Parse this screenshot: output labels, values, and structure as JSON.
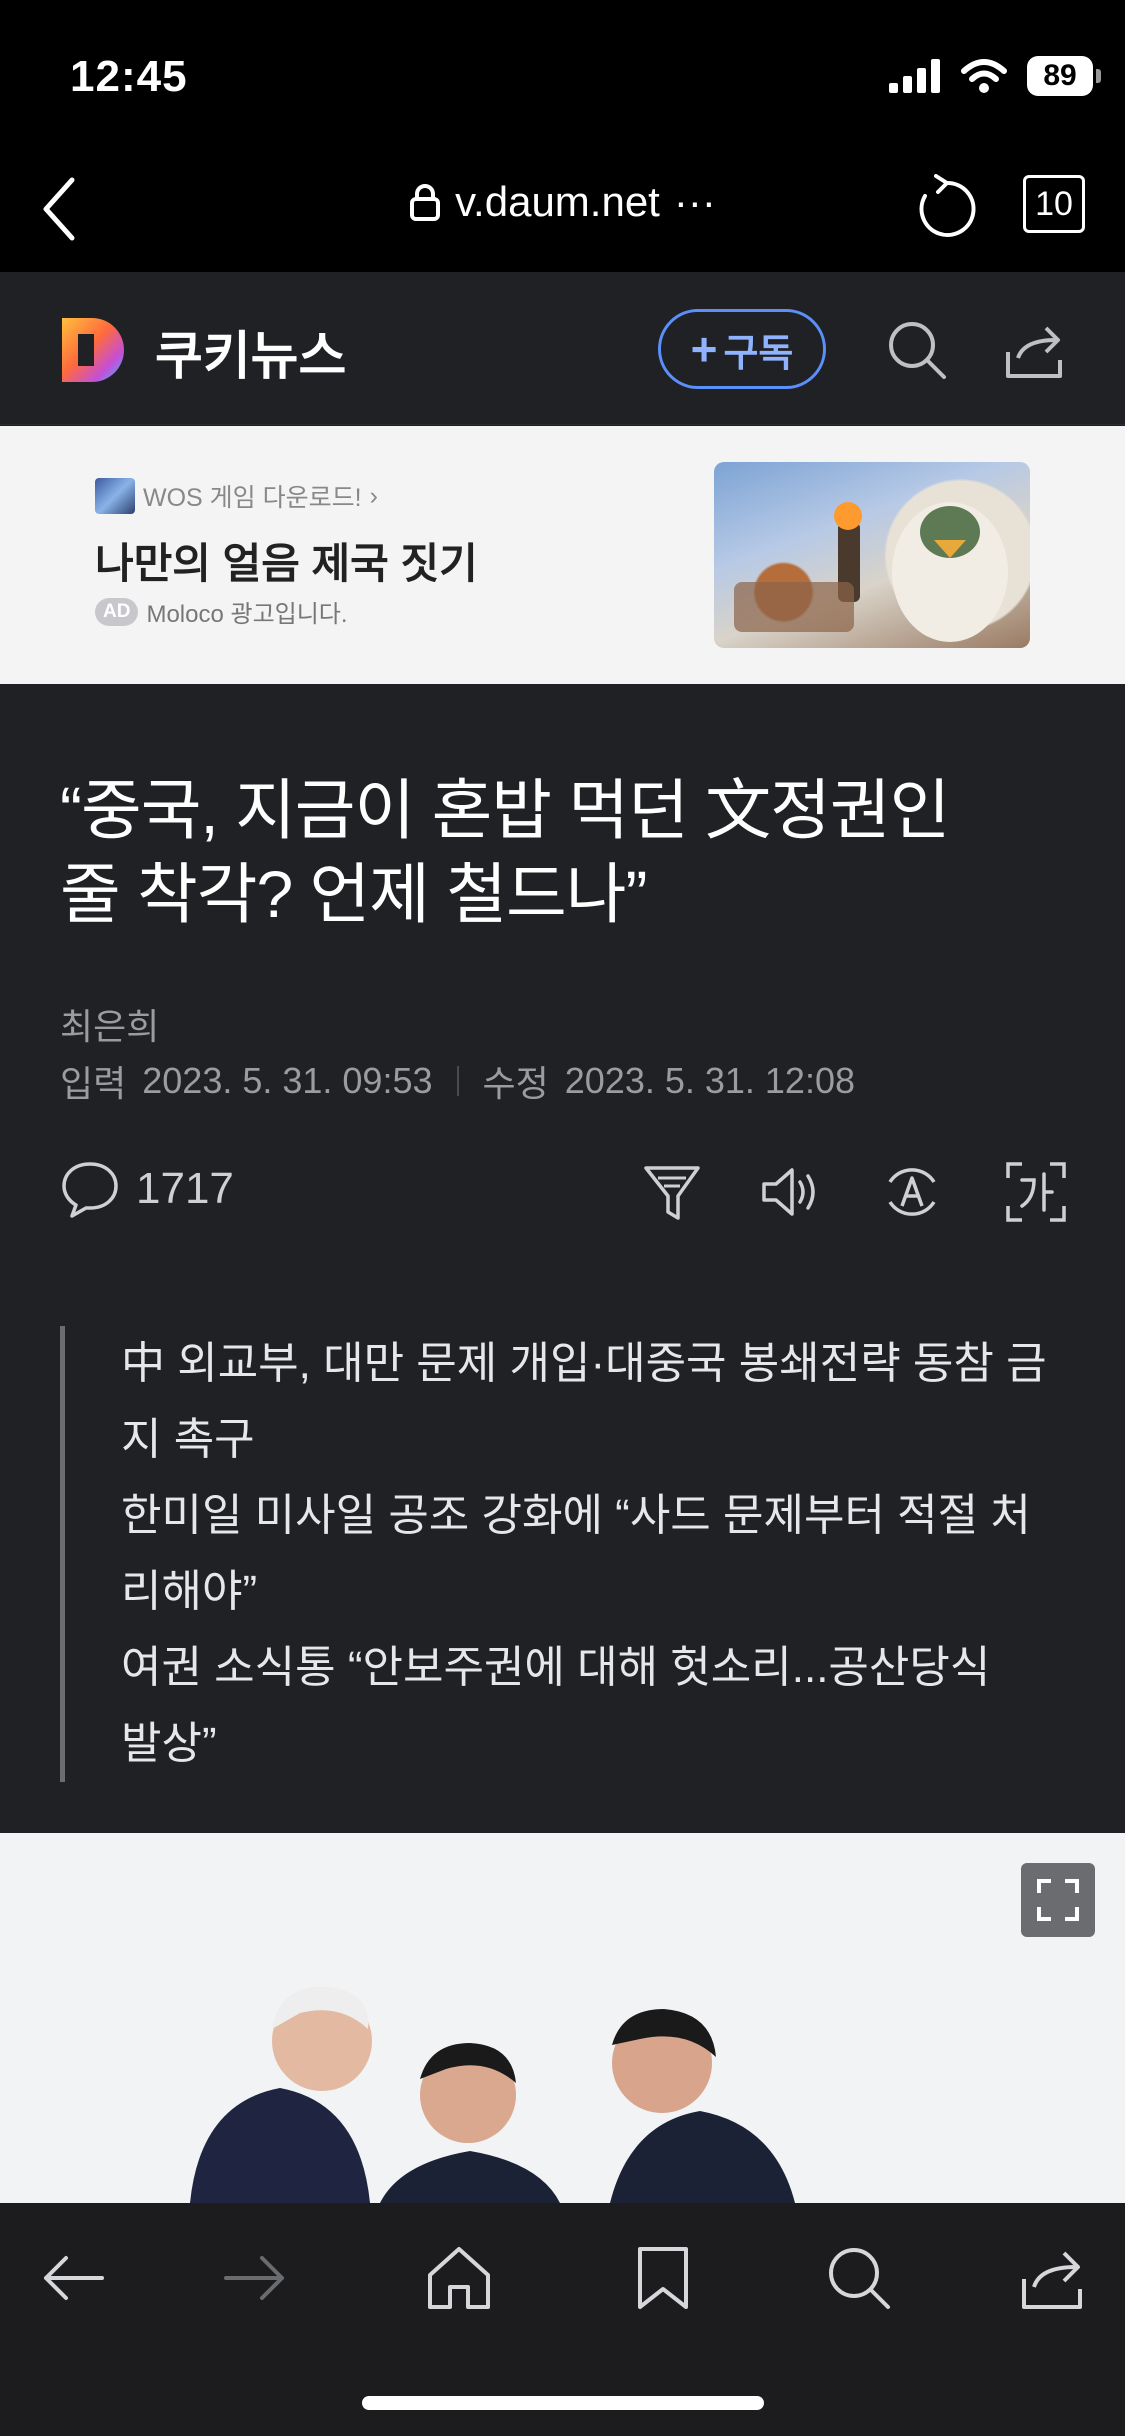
{
  "status_bar": {
    "time": "12:45",
    "battery": "89"
  },
  "browser": {
    "url": "v.daum.net",
    "more": "···",
    "tab_count": "10"
  },
  "site": {
    "brand": "쿠키뉴스",
    "subscribe_label": "구독",
    "brand_colors": [
      "#ffbf3d",
      "#ff6a3d",
      "#6d5cff",
      "#41b6ff"
    ]
  },
  "ad": {
    "source": "WOS 게임 다운로드!",
    "source_arrow": "›",
    "title": "나만의 얼음 제국 짓기",
    "badge": "AD",
    "advertiser": "Moloco 광고입니다."
  },
  "article": {
    "headline_line1": "“중국, 지금이 혼밥 먹던 文정권인",
    "headline_line2": "줄 착각? 언제 철드나”",
    "author": "최은희",
    "input_label": "입력",
    "input_date": "2023. 5. 31. 09:53",
    "edit_label": "수정",
    "edit_date": "2023. 5. 31. 12:08",
    "comment_count": "1717",
    "summary": [
      "中 외교부, 대만 문제 개입·대중국 봉쇄전략 동참 금",
      "지 촉구",
      "한미일 미사일 공조 강화에 “사드 문제부터 적절 처",
      "리해야”",
      "여권  소식통  “안보주권에  대해  헛소리...공산당식",
      "발상”"
    ]
  }
}
